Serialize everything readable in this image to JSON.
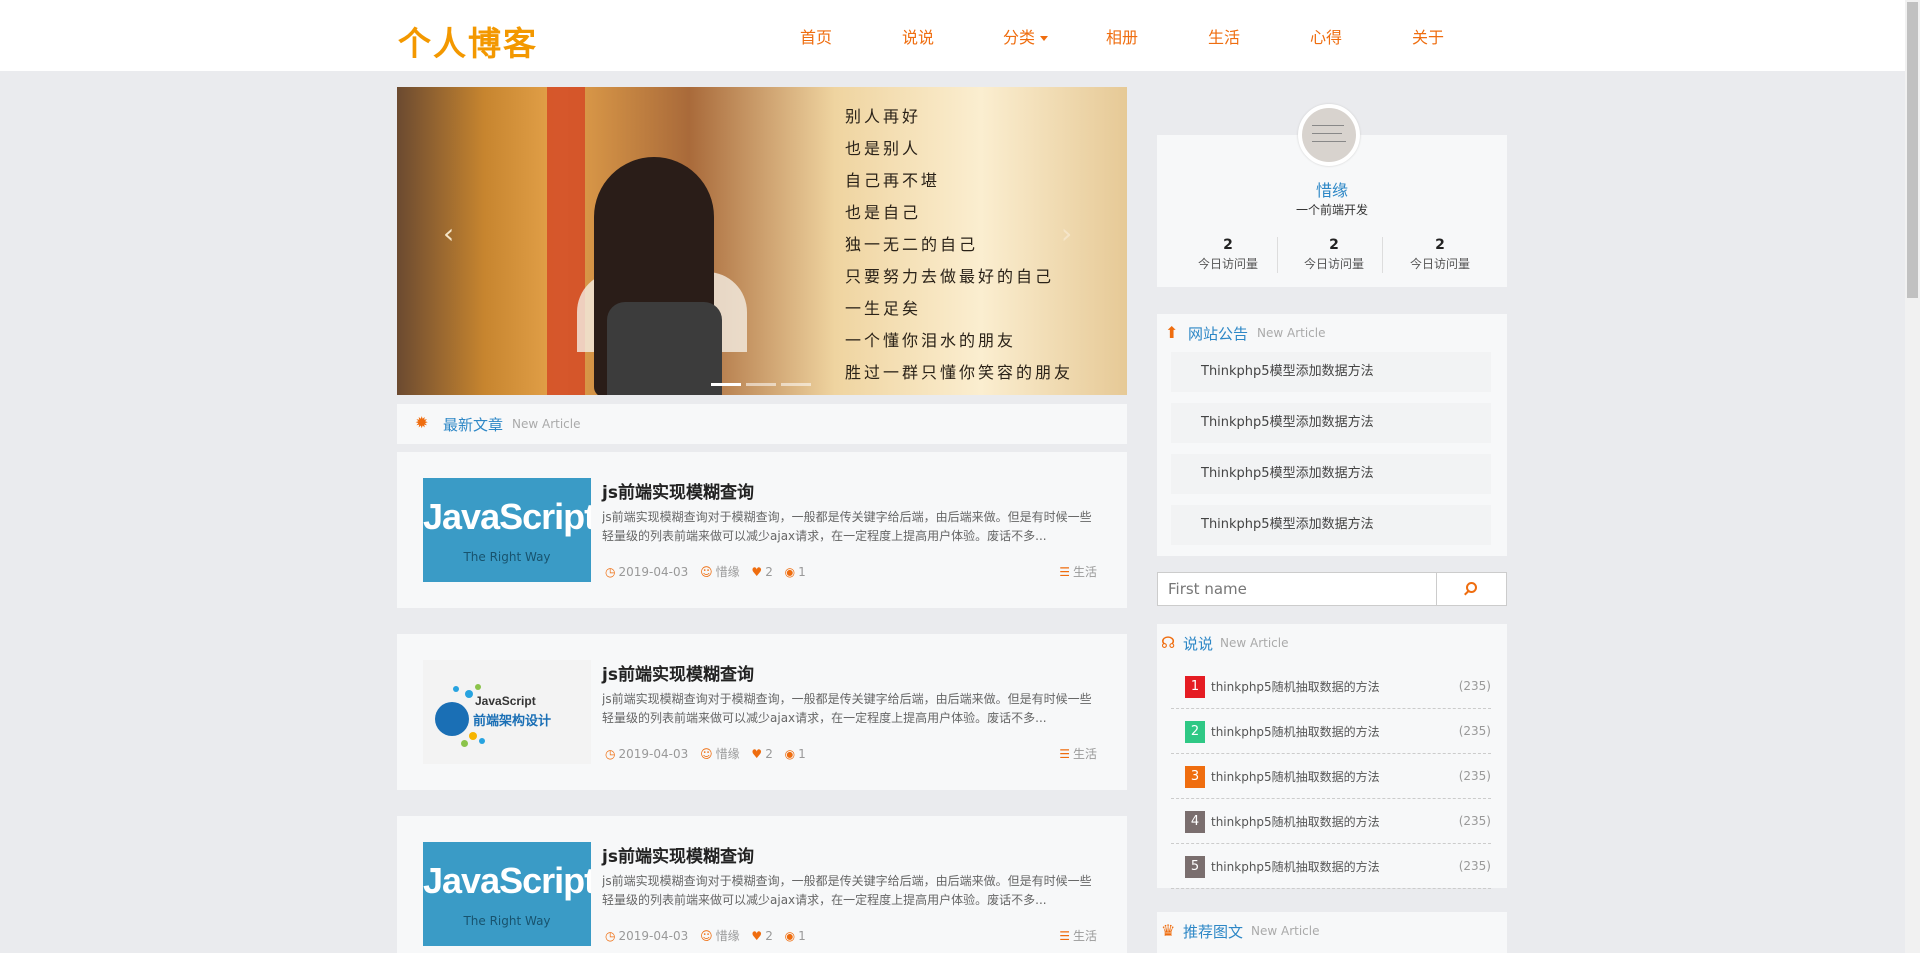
{
  "header": {
    "logo": "个人博客",
    "nav": [
      {
        "label": "首页"
      },
      {
        "label": "说说"
      },
      {
        "label": "分类"
      },
      {
        "label": "相册"
      },
      {
        "label": "生活"
      },
      {
        "label": "心得"
      },
      {
        "label": "关于"
      }
    ]
  },
  "carousel": {
    "poem": [
      "别人再好",
      "也是别人",
      "自己再不堪",
      "也是自己",
      "独一无二的自己",
      "只要努力去做最好的自己",
      "一生足矣",
      "一个懂你泪水的朋友",
      "胜过一群只懂你笑容的朋友"
    ],
    "prev_icon": "chevron-left-icon",
    "next_icon": "chevron-right-icon",
    "active_slide": 1,
    "slide_count": 3
  },
  "latest": {
    "title": "最新文章",
    "subtitle": "New Article"
  },
  "articles": [
    {
      "thumb_title": "JavaScript",
      "thumb_sub": "The Right Way",
      "title": "js前端实现模糊查询",
      "desc": "js前端实现模糊查询对于模糊查询，一般都是传关键字给后端，由后端来做。但是有时候一些轻量级的列表前端来做可以减少ajax请求，在一定程度上提高用户体验。废话不多...",
      "date": "2019-04-03",
      "author": "惜缘",
      "likes": "2",
      "views": "1",
      "category": "生活"
    },
    {
      "thumb_title": "JavaScript",
      "thumb_sub": "前端架构设计",
      "title": "js前端实现模糊查询",
      "desc": "js前端实现模糊查询对于模糊查询，一般都是传关键字给后端，由后端来做。但是有时候一些轻量级的列表前端来做可以减少ajax请求，在一定程度上提高用户体验。废话不多...",
      "date": "2019-04-03",
      "author": "惜缘",
      "likes": "2",
      "views": "1",
      "category": "生活"
    },
    {
      "thumb_title": "JavaScript",
      "thumb_sub": "The Right Way",
      "title": "js前端实现模糊查询",
      "desc": "js前端实现模糊查询对于模糊查询，一般都是传关键字给后端，由后端来做。但是有时候一些轻量级的列表前端来做可以减少ajax请求，在一定程度上提高用户体验。废话不多...",
      "date": "2019-04-03",
      "author": "惜缘",
      "likes": "2",
      "views": "1",
      "category": "生活"
    }
  ],
  "profile": {
    "name": "惜缘",
    "desc": "一个前端开发",
    "stats": [
      {
        "num": "2",
        "label": "今日访问量"
      },
      {
        "num": "2",
        "label": "今日访问量"
      },
      {
        "num": "2",
        "label": "今日访问量"
      }
    ]
  },
  "notice": {
    "title": "网站公告",
    "subtitle": "New Article",
    "items": [
      {
        "label": "Thinkphp5模型添加数据方法"
      },
      {
        "label": "Thinkphp5模型添加数据方法"
      },
      {
        "label": "Thinkphp5模型添加数据方法"
      },
      {
        "label": "Thinkphp5模型添加数据方法"
      }
    ]
  },
  "search": {
    "placeholder": "First name"
  },
  "shuoshuo": {
    "title": "说说",
    "subtitle": "New Article",
    "items": [
      {
        "rank": "1",
        "label": "thinkphp5随机抽取数据的方法",
        "count": "(235)",
        "color": "#e51c23"
      },
      {
        "rank": "2",
        "label": "thinkphp5随机抽取数据的方法",
        "count": "(235)",
        "color": "#2fc885"
      },
      {
        "rank": "3",
        "label": "thinkphp5随机抽取数据的方法",
        "count": "(235)",
        "color": "#ef6d0f"
      },
      {
        "rank": "4",
        "label": "thinkphp5随机抽取数据的方法",
        "count": "(235)",
        "color": "#7a6e6e"
      },
      {
        "rank": "5",
        "label": "thinkphp5随机抽取数据的方法",
        "count": "(235)",
        "color": "#7a6e6e"
      }
    ]
  },
  "recommend": {
    "title": "推荐图文",
    "subtitle": "New Article"
  },
  "colors": {
    "accent": "#ef6d0f",
    "link": "#2d87c6",
    "background": "#eaebee"
  }
}
